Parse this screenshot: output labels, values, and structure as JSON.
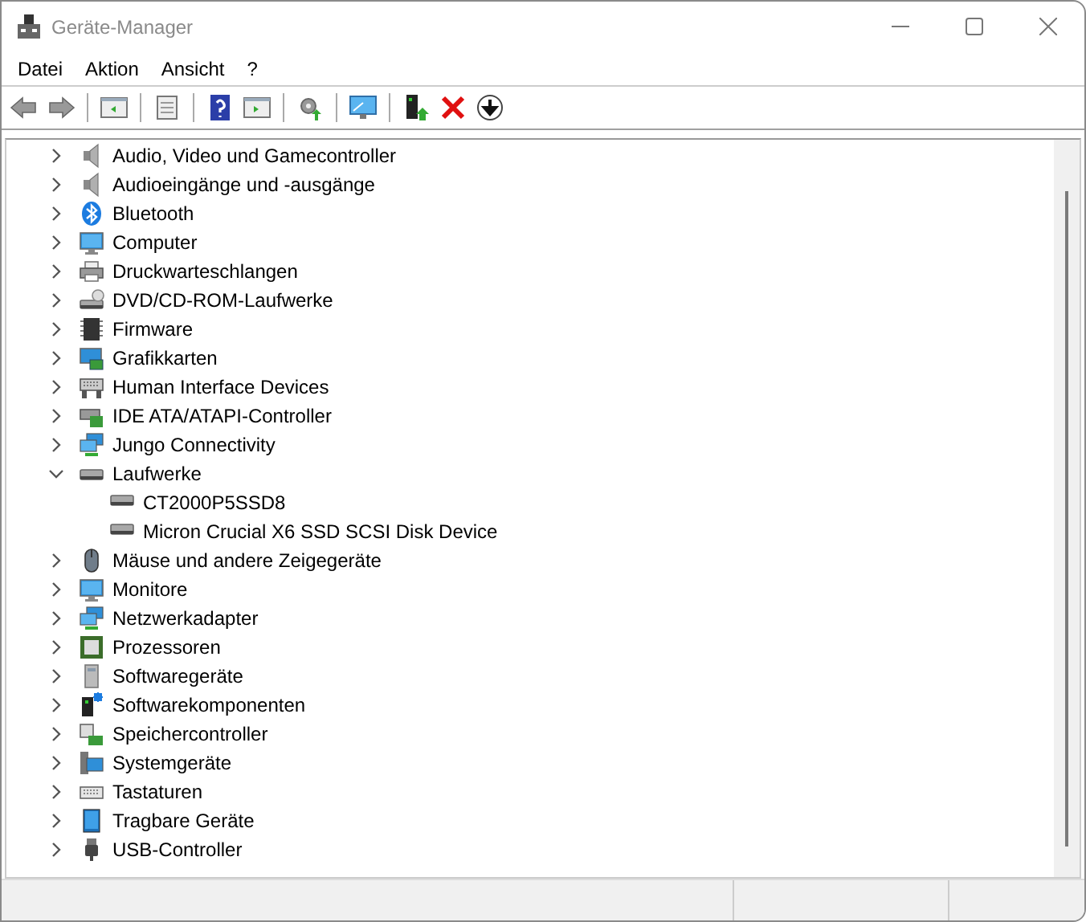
{
  "window": {
    "title": "Geräte-Manager"
  },
  "menu": [
    "Datei",
    "Aktion",
    "Ansicht",
    "?"
  ],
  "tree": [
    {
      "label": "Audio, Video und Gamecontroller",
      "expanded": false
    },
    {
      "label": "Audioeingänge und -ausgänge",
      "expanded": false
    },
    {
      "label": "Bluetooth",
      "expanded": false
    },
    {
      "label": "Computer",
      "expanded": false
    },
    {
      "label": "Druckwarteschlangen",
      "expanded": false
    },
    {
      "label": "DVD/CD-ROM-Laufwerke",
      "expanded": false
    },
    {
      "label": "Firmware",
      "expanded": false
    },
    {
      "label": "Grafikkarten",
      "expanded": false
    },
    {
      "label": "Human Interface Devices",
      "expanded": false
    },
    {
      "label": "IDE ATA/ATAPI-Controller",
      "expanded": false
    },
    {
      "label": "Jungo Connectivity",
      "expanded": false
    },
    {
      "label": "Laufwerke",
      "expanded": true,
      "children": [
        {
          "label": "CT2000P5SSD8"
        },
        {
          "label": "Micron Crucial X6 SSD SCSI Disk Device"
        }
      ]
    },
    {
      "label": "Mäuse und andere Zeigegeräte",
      "expanded": false
    },
    {
      "label": "Monitore",
      "expanded": false
    },
    {
      "label": "Netzwerkadapter",
      "expanded": false
    },
    {
      "label": "Prozessoren",
      "expanded": false
    },
    {
      "label": "Softwaregeräte",
      "expanded": false
    },
    {
      "label": "Softwarekomponenten",
      "expanded": false
    },
    {
      "label": "Speichercontroller",
      "expanded": false
    },
    {
      "label": "Systemgeräte",
      "expanded": false
    },
    {
      "label": "Tastaturen",
      "expanded": false
    },
    {
      "label": "Tragbare Geräte",
      "expanded": false
    },
    {
      "label": "USB-Controller",
      "expanded": false
    }
  ]
}
